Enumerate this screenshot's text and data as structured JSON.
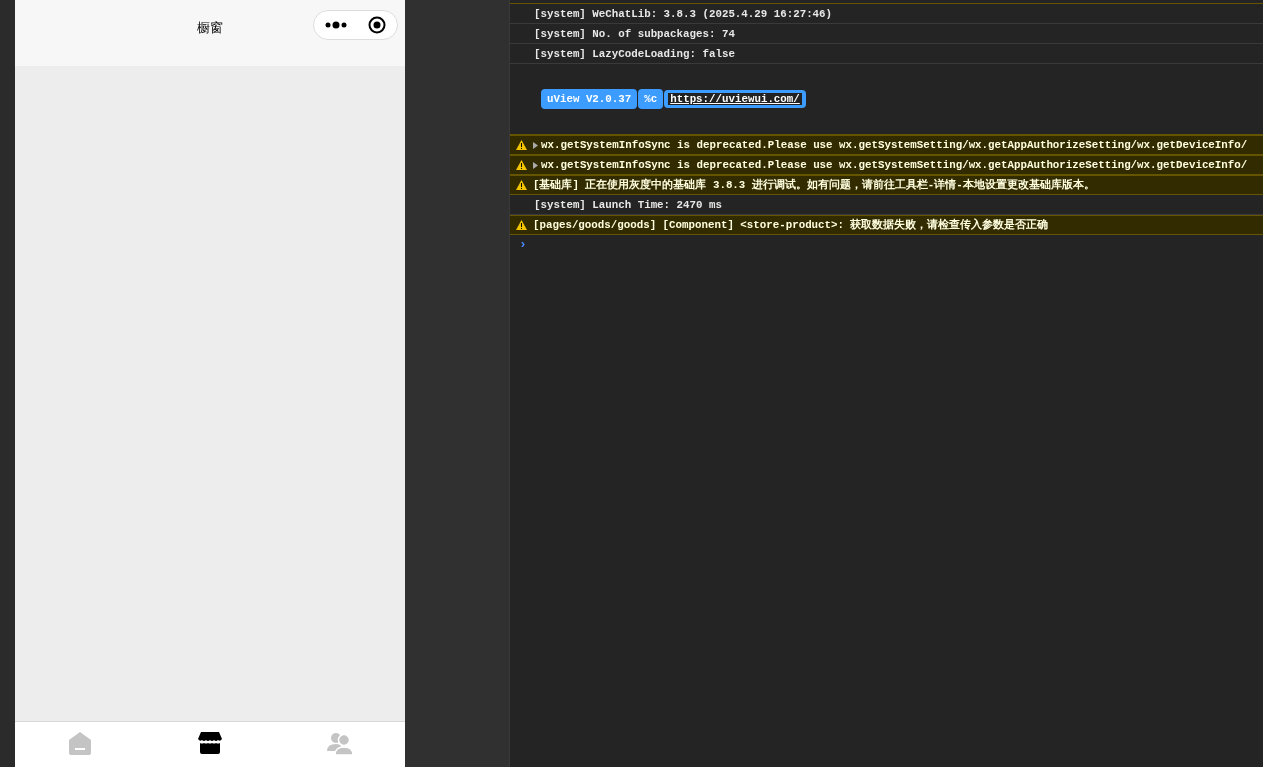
{
  "phone": {
    "nav_bar": {
      "title": "橱窗"
    },
    "tab_bar": [
      {
        "kind": "home",
        "selected": false
      },
      {
        "kind": "store",
        "selected": true
      },
      {
        "kind": "users",
        "selected": false
      }
    ]
  },
  "console": {
    "entries": [
      {
        "kind": "system",
        "text": "[system] WeChatLib: 3.8.3 (2025.4.29 16:27:46)"
      },
      {
        "kind": "system",
        "text": "[system] No. of subpackages: 74"
      },
      {
        "kind": "system",
        "text": "[system] LazyCodeLoading: false"
      },
      {
        "kind": "styled",
        "segments": [
          {
            "text": "uView V2.0.37",
            "link": false
          },
          {
            "text": "%c",
            "link": false
          },
          {
            "text": "https://uviewui.com/",
            "link": true
          }
        ]
      },
      {
        "kind": "warning",
        "expandable": true,
        "text": "wx.getSystemInfoSync is deprecated.Please use wx.getSystemSetting/wx.getAppAuthorizeSetting/wx.getDeviceInfo/"
      },
      {
        "kind": "warning",
        "expandable": true,
        "text": "wx.getSystemInfoSync is deprecated.Please use wx.getSystemSetting/wx.getAppAuthorizeSetting/wx.getDeviceInfo/"
      },
      {
        "kind": "warning",
        "expandable": false,
        "text": "[基础库] 正在使用灰度中的基础库 3.8.3 进行调试。如有问题，请前往工具栏-详情-本地设置更改基础库版本。"
      },
      {
        "kind": "system",
        "text": "[system] Launch Time: 2470 ms"
      },
      {
        "kind": "warning",
        "expandable": false,
        "text": "[pages/goods/goods] [Component] <store-product>: 获取数据失败，请检查传入参数是否正确"
      }
    ],
    "prompt": "›"
  }
}
